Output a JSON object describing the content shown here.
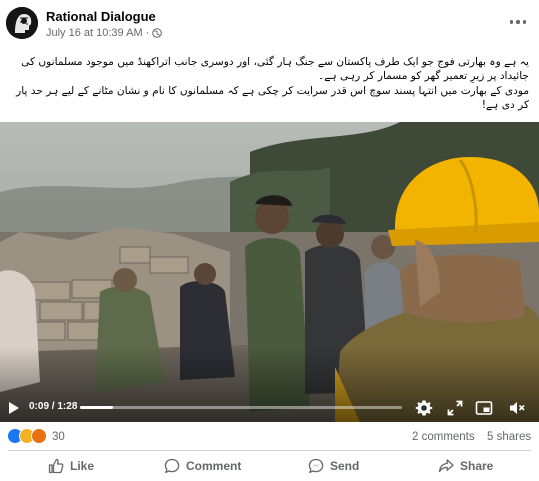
{
  "post": {
    "author": "Rational Dialogue",
    "date": "July 16 at 10:39 AM",
    "separator": "·",
    "caption": [
      "یہ ہے وہ بھارتی فوج جو ایک طرف پاکستان سے جنگ ہار گئی، اور دوسری جانب اتراکھنڈ میں موجود مسلمانوں کی جائیداد پر زیرِ تعمیر گھر کو مسمار کر رہی ہے۔",
      "مودی کے بھارت میں انتہا پسند سوچ اس قدر سرایت کر چکی ہے کہ مسلمانوں کا نام و نشان مٹانے کے لیے ہر حد پار کر دی ہے!"
    ]
  },
  "video": {
    "current_time": "0:09",
    "total_time": "1:28",
    "time_separator": " / ",
    "progress": 0.102
  },
  "stats": {
    "reaction_count": "30",
    "comments": "2 comments",
    "shares": "5 shares"
  },
  "actions": {
    "like": "Like",
    "comment": "Comment",
    "send": "Send",
    "share": "Share"
  },
  "colors": {
    "secondary_text": "#65676b",
    "like_blue": "#1877f2",
    "haha_yellow": "#f7b125",
    "angry_red": "#e9710f",
    "helmet_yellow": "#f2b400"
  },
  "icons": [
    "globe-icon",
    "more-options-icon",
    "play-icon",
    "settings-icon",
    "fullscreen-icon",
    "pip-icon",
    "volume-icon",
    "like-icon",
    "comment-icon",
    "send-icon",
    "share-icon"
  ]
}
